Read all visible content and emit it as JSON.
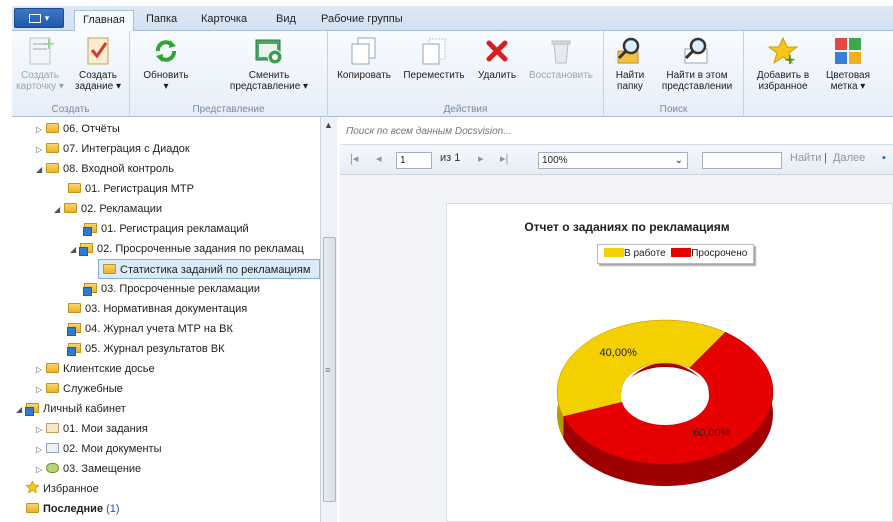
{
  "tabs": [
    "Главная",
    "Папка",
    "Карточка",
    "Вид",
    "Рабочие группы"
  ],
  "ribbon": {
    "create_card": "Создать карточку",
    "create_task": "Создать задание",
    "group_create": "Создать",
    "refresh": "Обновить",
    "change_view": "Сменить представление",
    "group_view": "Представление",
    "copy": "Копировать",
    "move": "Переместить",
    "delete": "Удалить",
    "restore": "Восстановить",
    "group_actions": "Действия",
    "find_folder": "Найти папку",
    "find_in_view": "Найти в этом представлении",
    "group_search": "Поиск",
    "add_favorites": "Добавить в избранное",
    "color_label": "Цветовая метка"
  },
  "tree": [
    "06. Отчёты",
    "07. Интеграция с Диадок",
    "08. Входной контроль",
    "01. Регистрация МТР",
    "02. Рекламации",
    "01. Регистрация рекламаций",
    "02. Просроченные задания по рекламац",
    "Статистика заданий по рекламациям",
    "03. Просроченные рекламации",
    "03. Нормативная документация",
    "04. Журнал учета МТР на ВК",
    "05. Журнал результатов ВК",
    "Клиентские досье",
    "Служебные",
    "Личный кабинет",
    "01. Мои задания",
    "02. Мои документы",
    "03. Замещение",
    "Избранное",
    "Последние"
  ],
  "recent_count": "(1)",
  "search": {
    "placeholder": "Поиск по всем данным Docsvision..."
  },
  "report_toolbar": {
    "page": "1",
    "of": "из 1",
    "zoom": "100%",
    "find": "Найти",
    "sep": "|",
    "next": "Далее"
  },
  "colors": {
    "in_work": "#f5d000",
    "overdue": "#e60000"
  },
  "chart_data": {
    "type": "pie",
    "title": "Отчет о заданиях по рекламациям",
    "categories": [
      "В работе",
      "Просрочено"
    ],
    "values": [
      40,
      60
    ],
    "labels": [
      "40,00%",
      "60,00%"
    ],
    "legend": "top"
  }
}
